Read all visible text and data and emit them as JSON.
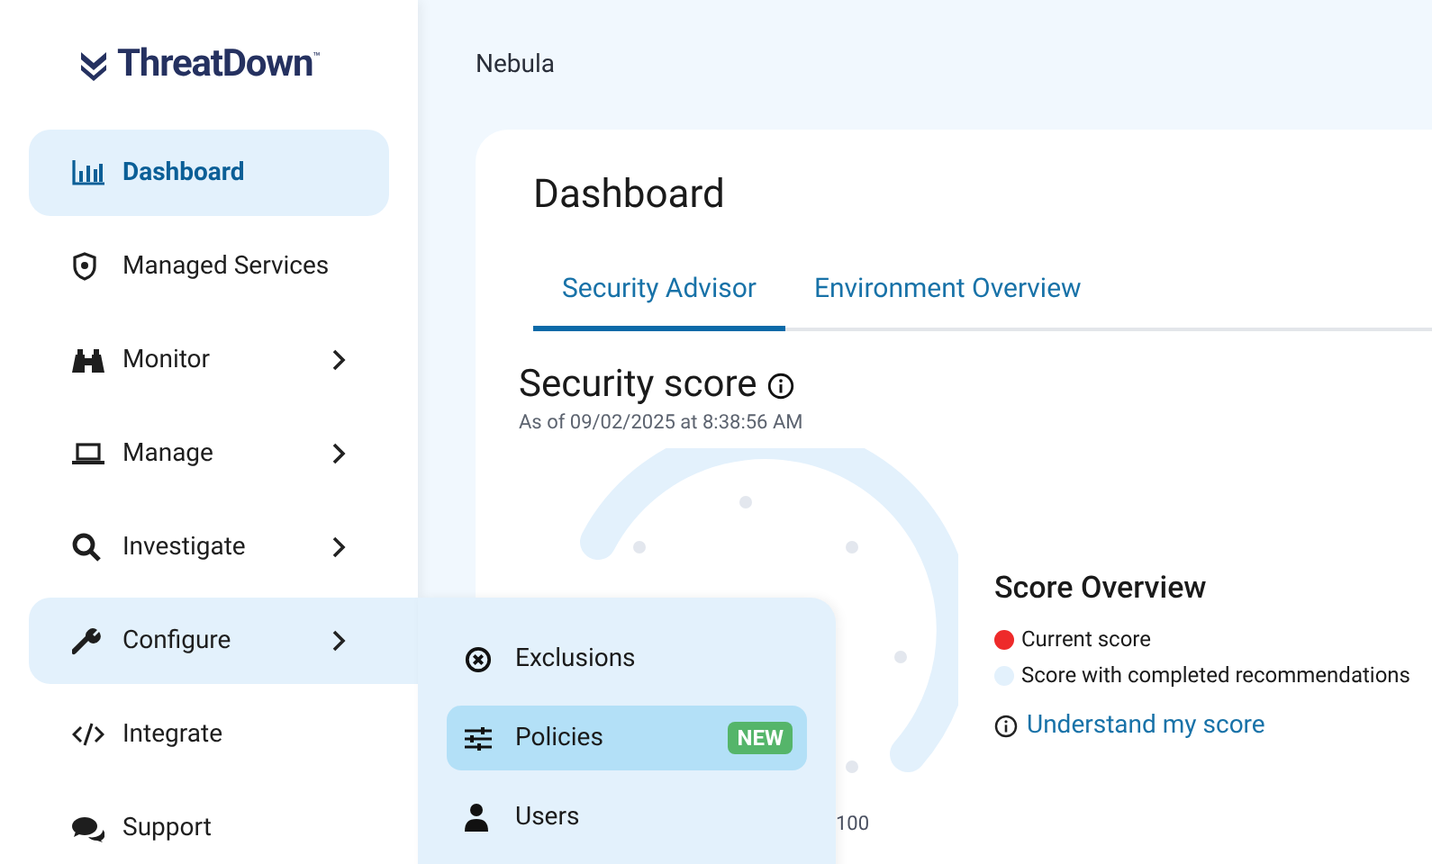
{
  "logo": {
    "name": "ThreatDown",
    "mark": "™"
  },
  "sidebar": {
    "items": [
      {
        "label": "Dashboard",
        "selected": true,
        "expandable": false
      },
      {
        "label": "Managed Services",
        "selected": false,
        "expandable": false
      },
      {
        "label": "Monitor",
        "selected": false,
        "expandable": true
      },
      {
        "label": "Manage",
        "selected": false,
        "expandable": true
      },
      {
        "label": "Investigate",
        "selected": false,
        "expandable": true
      },
      {
        "label": "Configure",
        "selected": false,
        "expandable": true,
        "expanded": true
      },
      {
        "label": "Integrate",
        "selected": false,
        "expandable": false
      },
      {
        "label": "Support",
        "selected": false,
        "expandable": false
      }
    ]
  },
  "submenu": {
    "items": [
      {
        "label": "Exclusions",
        "selected": false
      },
      {
        "label": "Policies",
        "selected": true,
        "badge": "NEW"
      },
      {
        "label": "Users",
        "selected": false
      }
    ]
  },
  "breadcrumb": "Nebula",
  "page_title": "Dashboard",
  "tabs": [
    {
      "label": "Security Advisor",
      "selected": true
    },
    {
      "label": "Environment Overview",
      "selected": false
    }
  ],
  "security_score": {
    "title": "Security score",
    "timestamp": "As of 09/02/2025 at 8:38:56 AM",
    "gauge_max_label": "100"
  },
  "score_overview": {
    "title": "Score Overview",
    "legend": [
      {
        "label": "Current score",
        "color": "#ee2a2a"
      },
      {
        "label": "Score with completed recommendations",
        "color": "#e3f1fc"
      }
    ],
    "link": "Understand my score"
  }
}
